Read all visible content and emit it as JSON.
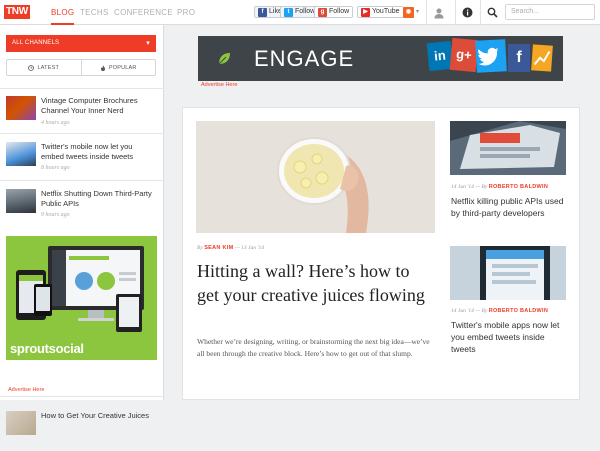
{
  "topbar": {
    "logo": "TNW",
    "nav": [
      "BLOG",
      "TECHS",
      "CONFERENCE",
      "PRO"
    ],
    "social": {
      "fb_label": "Like",
      "tw_label": "Follow",
      "gplus_label": "Follow",
      "yt_label": "YouTube"
    },
    "search_placeholder": "Search..."
  },
  "sidebar": {
    "channels_label": "ALL CHANNELS",
    "tabs": [
      "LATEST",
      "POPULAR"
    ],
    "items": [
      {
        "title": "Vintage Computer Brochures Channel Your Inner Nerd",
        "time": "4 hours ago"
      },
      {
        "title": "Twitter's mobile now let you embed tweets inside tweets",
        "time": "8 hours ago"
      },
      {
        "title": "Netflix Shutting Down Third-Party Public APIs",
        "time": "9 hours ago"
      },
      {
        "title": "How to Get Your Creative Juices",
        "time": ""
      }
    ],
    "ad_brand": "sproutsocial",
    "ad_caption": "Advertise Here"
  },
  "banner": {
    "text": "ENGAGE",
    "caption": "Advertise Here"
  },
  "main_article": {
    "author_prefix": "By",
    "author": "SEAN KIM",
    "date": "13 Jun '14",
    "title": "Hitting a wall? Here’s how to get your creative juices flowing",
    "excerpt": "Whether we’re designing, writing, or brainstorming the next big idea—we’ve all been through the creative block. Here’s how to get out of that slump."
  },
  "side_articles": [
    {
      "date": "14 Jun '14",
      "author": "ROBERTO BALDWIN",
      "title": "Netflix killing public APIs used by third-party developers"
    },
    {
      "date": "14 Jun '14",
      "author": "ROBERTO BALDWIN",
      "title": "Twitter's mobile apps now let you embed tweets inside tweets"
    }
  ],
  "colors": {
    "accent": "#ee3c26",
    "ad_green": "#8cc63f",
    "banner_dark": "#3f4448"
  }
}
